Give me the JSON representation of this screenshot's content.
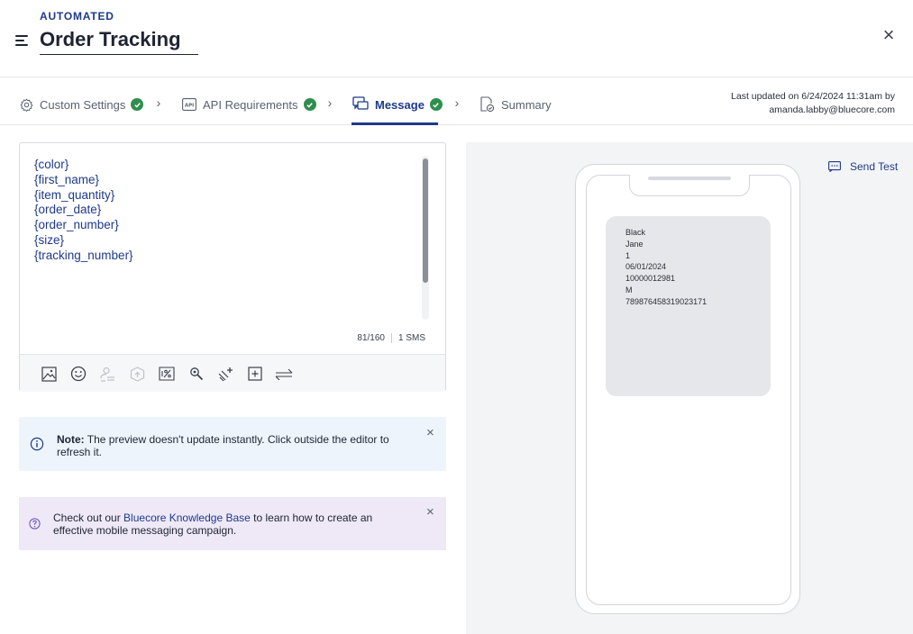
{
  "header": {
    "eyebrow": "AUTOMATED",
    "title": "Order Tracking",
    "close_label": "×"
  },
  "stepper": {
    "steps": [
      {
        "label": "Custom Settings",
        "icon": "gear-icon",
        "done": true
      },
      {
        "label": "API Requirements",
        "icon": "api-icon",
        "done": true
      },
      {
        "label": "Message",
        "icon": "message-icon",
        "done": true,
        "active": true
      },
      {
        "label": "Summary",
        "icon": "summary-icon",
        "done": false
      }
    ],
    "separator": "›",
    "updated_line1": "Last updated on 6/24/2024 11:31am by",
    "updated_line2": "amanda.labby@bluecore.com"
  },
  "editor": {
    "lines": [
      "{color}",
      "{first_name}",
      "{item_quantity}",
      "{order_date}",
      "{order_number}",
      "{size}",
      "{tracking_number}"
    ],
    "char_count": "81/160",
    "sms_count": "1 SMS",
    "tools": [
      "image-icon",
      "emoji-icon",
      "personalize-icon",
      "product-icon",
      "discount-icon",
      "zoom-link-icon",
      "link-icon",
      "insert-block-icon",
      "shorten-icon"
    ]
  },
  "note": {
    "bold": "Note:",
    "text": " The preview doesn't update instantly. Click outside the editor to refresh it.",
    "close": "×"
  },
  "kb": {
    "prefix": "Check out our ",
    "link": "Bluecore Knowledge Base",
    "suffix": " to learn how to create an effective mobile messaging campaign.",
    "close": "×"
  },
  "preview": {
    "send_test": "Send Test",
    "message_lines": [
      "Black",
      "Jane",
      "1",
      "06/01/2024",
      "10000012981",
      "M",
      "789876458319023171"
    ]
  },
  "colors": {
    "accent": "#1e3a8a",
    "success": "#2f8f4e",
    "note_bg": "#eef4fc",
    "kb_bg": "#eee8f7"
  }
}
